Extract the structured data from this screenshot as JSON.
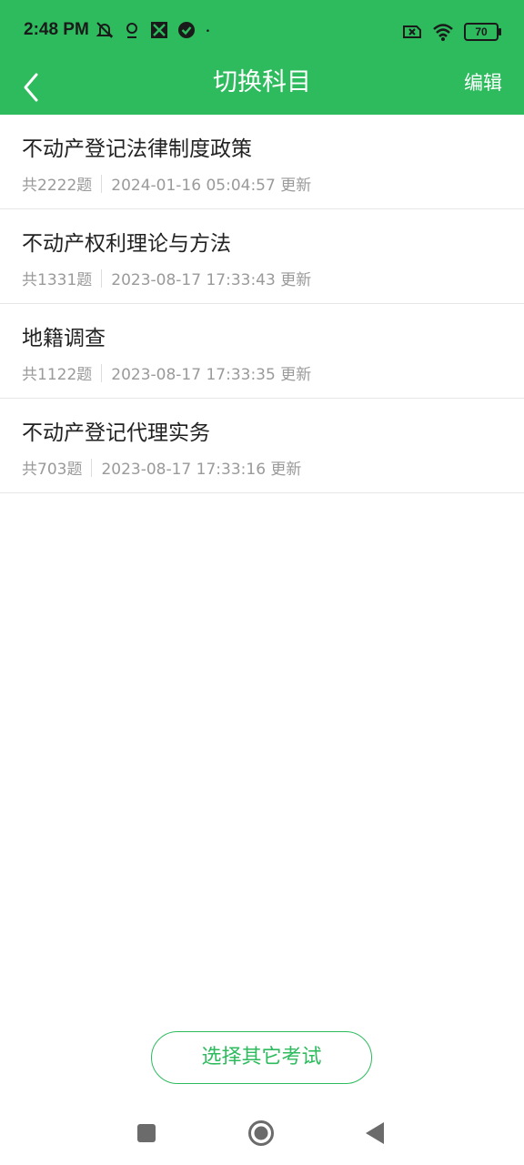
{
  "status_bar": {
    "time": "2:48 PM",
    "battery_level": "70",
    "icons_left": [
      "mute-icon",
      "location-icon",
      "app-notification-icon",
      "check-circle-icon",
      "dot-icon"
    ],
    "icons_right": [
      "sim-off-icon",
      "wifi-icon",
      "battery-icon"
    ]
  },
  "header": {
    "title": "切换科目",
    "edit_label": "编辑",
    "back_icon": "chevron-left-icon"
  },
  "subjects": [
    {
      "name": "不动产登记法律制度政策",
      "count": "共2222题",
      "updated": "2024-01-16 05:04:57 更新"
    },
    {
      "name": "不动产权利理论与方法",
      "count": "共1331题",
      "updated": "2023-08-17 17:33:43 更新"
    },
    {
      "name": "地籍调查",
      "count": "共1122题",
      "updated": "2023-08-17 17:33:35 更新"
    },
    {
      "name": "不动产登记代理实务",
      "count": "共703题",
      "updated": "2023-08-17 17:33:16 更新"
    }
  ],
  "footer": {
    "choose_other_label": "选择其它考试"
  },
  "nav_bar": {
    "icons": [
      "recents-icon",
      "home-icon",
      "back-icon"
    ]
  },
  "colors": {
    "brand_green": "#2dbb5e",
    "text_primary": "#222222",
    "text_secondary": "#9a9a9a"
  }
}
